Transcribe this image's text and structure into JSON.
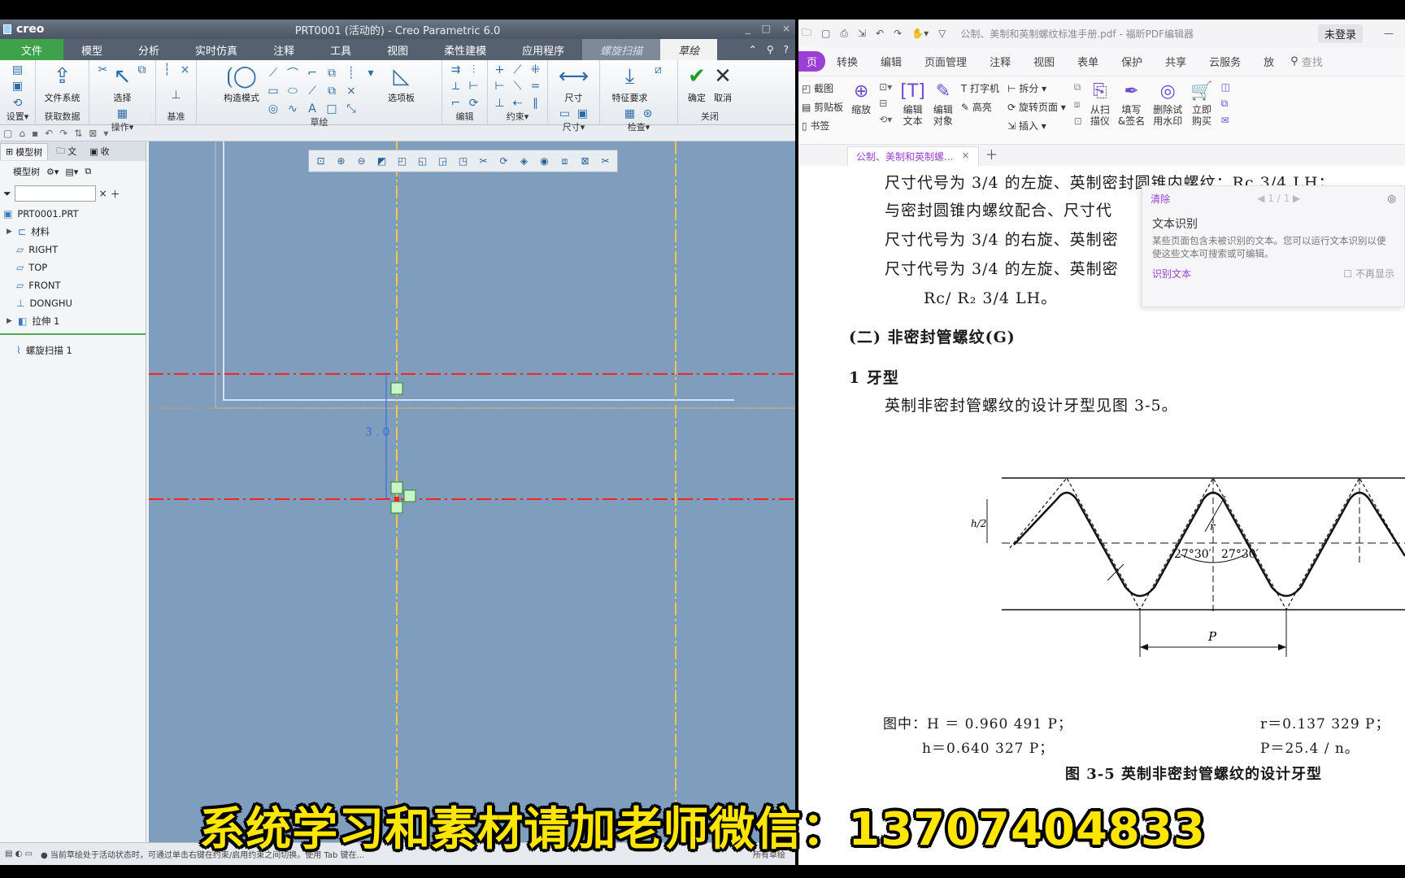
{
  "creo": {
    "brand": "creo",
    "title": "PRT0001 (活动的) - Creo Parametric 6.0",
    "tabs": [
      "文件",
      "模型",
      "分析",
      "实时仿真",
      "注释",
      "工具",
      "视图",
      "柔性建模",
      "应用程序",
      "螺旋扫描",
      "草绘"
    ],
    "ribbon_groups": {
      "setup": "设置▾",
      "get_data": "获取数据",
      "operations": "操作▾",
      "datum": "基准",
      "sketch": "草绘",
      "edit": "编辑",
      "constrain": "约束▾",
      "dimension": "尺寸▾",
      "inspect": "检查▾",
      "close": "关闭"
    },
    "ribbon_buttons": {
      "file_system": "文件系统",
      "select": "选择",
      "construct_mode": "构造模式",
      "palette": "选项板",
      "dimension": "尺寸",
      "feature_requirements": "特征要求",
      "ok": "确定",
      "cancel": "取消"
    },
    "tree_tabs": [
      "模型树",
      "文",
      "收"
    ],
    "tree_toolbar_label": "模型树",
    "tree_items": [
      {
        "label": "PRT0001.PRT",
        "icon": "part-icon"
      },
      {
        "label": "材料",
        "icon": "material-icon"
      },
      {
        "label": "RIGHT",
        "icon": "plane-icon"
      },
      {
        "label": "TOP",
        "icon": "plane-icon"
      },
      {
        "label": "FRONT",
        "icon": "plane-icon"
      },
      {
        "label": "DONGHU",
        "icon": "csys-icon"
      },
      {
        "label": "拉伸 1",
        "icon": "extrude-icon"
      },
      {
        "label": "螺旋扫描 1",
        "icon": "helical-sweep-icon"
      }
    ],
    "dimension_text": "3.0",
    "status": "● 当前草绘处于活动状态时，可通过单击右键在约束/启用约束之间切换。使用 Tab 键在...",
    "status_right": "所有草绘"
  },
  "pdf": {
    "window_title": "公制、美制和英制螺纹标准手册.pdf - 福昕PDF编辑器",
    "login": "未登录",
    "menu": [
      "页",
      "转换",
      "编辑",
      "页面管理",
      "注释",
      "视图",
      "表单",
      "保护",
      "共享",
      "云服务",
      "放"
    ],
    "search_placeholder": "查找",
    "ribbon": {
      "screenshot": "截图",
      "clipboard": "剪贴板",
      "bookmark": "书签",
      "zoom": "缩放",
      "edit_text": "编辑\n文本",
      "edit_object": "编辑\n对象",
      "typewriter": "打字机",
      "highlight": "高亮",
      "split": "拆分",
      "rotate_page": "旋转页面",
      "insert": "插入",
      "from_scan": "从扫\n描仪",
      "fill_sign": "填写\n&签名",
      "remove_watermark": "删除试\n用水印",
      "buy_now": "立即\n购买"
    },
    "doc_tab": "公制、美制和英制螺...",
    "ocr": {
      "clear": "清除",
      "page": "1 / 1",
      "title": "文本识别",
      "desc": "某些页面包含未被识别的文本。您可以运行文本识别以便使这些文本可搜索或可编辑。",
      "link": "识别文本",
      "no_more": "不再显示"
    },
    "page_lines": [
      "尺寸代号为 3/4 的左旋、英制密封圆锥内螺纹：Rc 3/4 LH；",
      "与密封圆锥内螺纹配合、尺寸代",
      "尺寸代号为 3/4 的右旋、英制密",
      "尺寸代号为 3/4 的左旋、英制密",
      "Rc/ R₂ 3/4 LH。",
      "(二) 非密封管螺纹(G)",
      "1  牙型",
      "英制非密封管螺纹的设计牙型见图 3-5。"
    ],
    "figure": {
      "angle_left": "27°30′",
      "angle_right": "27°30′",
      "label_p": "P",
      "label_h": "h/2",
      "label_r": "r"
    },
    "formula": {
      "left1": "图中：H ＝ 0.960 491 P；",
      "right1": "r＝0.137 329 P；",
      "left2": "h＝0.640 327 P；",
      "right2": "P＝25.4 / n。"
    },
    "caption": "图 3-5   英制非密封管螺纹的设计牙型"
  },
  "overlay_caption": "系统学习和素材请加老师微信：13707404833"
}
